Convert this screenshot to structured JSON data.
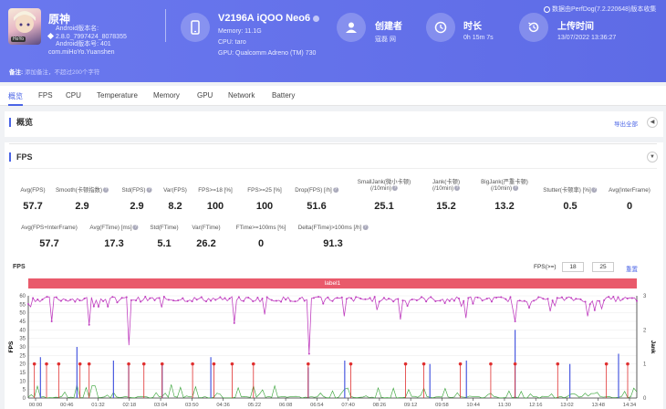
{
  "app": {
    "name": "原神",
    "meta": [
      "Android版本名:",
      "2.8.0_7997424_8078355",
      "Android版本号: 401",
      "com.miHoYo.Yuanshen"
    ],
    "icon_badge": "HoYo"
  },
  "device": {
    "title": "V2196A iQOO Neo6",
    "memory": "Memory: 11.1G",
    "cpu": "CPU: taro",
    "gpu": "GPU: Qualcomm Adreno (TM) 730"
  },
  "creator": {
    "title": "创建者",
    "value": "寇磊 网"
  },
  "duration": {
    "title": "时长",
    "value": "0h 15m 7s"
  },
  "upload": {
    "title": "上传时间",
    "value": "13/07/2022 13:36:27"
  },
  "version_note": "数据由PerfDog(7.2.220648)版本收集",
  "remark": {
    "label": "备注:",
    "placeholder": "添加备注，不超过200个字符"
  },
  "tabs": [
    "概览",
    "FPS",
    "CPU",
    "Temperature",
    "Memory",
    "GPU",
    "Network",
    "Battery"
  ],
  "overview": {
    "title": "概览",
    "export": "导出全部"
  },
  "fps_section": {
    "title": "FPS",
    "row1": [
      {
        "label": "Avg(FPS)",
        "value": "57.7",
        "help": false
      },
      {
        "label": "Smooth(卡顿指数)",
        "value": "2.9",
        "help": true
      },
      {
        "label": "Std(FPS)",
        "value": "2.9",
        "help": true
      },
      {
        "label": "Var(FPS)",
        "value": "8.2",
        "help": false
      },
      {
        "label": "FPS>=18 [%]",
        "value": "100",
        "help": false
      },
      {
        "label": "FPS>=25 [%]",
        "value": "100",
        "help": false
      },
      {
        "label": "Drop(FPS) [/h]",
        "value": "51.6",
        "help": true
      },
      {
        "label": "SmallJank(微小卡顿)\n(/10min)",
        "value": "25.1",
        "help": true
      },
      {
        "label": "Jank(卡顿)\n(/10min)",
        "value": "15.2",
        "help": true
      },
      {
        "label": "BigJank(严重卡顿)\n(/10min)",
        "value": "13.2",
        "help": true
      },
      {
        "label": "Stutter(卡顿率) [%]",
        "value": "0.5",
        "help": true
      },
      {
        "label": "Avg(InterFrame)",
        "value": "0",
        "help": false
      }
    ],
    "row2": [
      {
        "label": "Avg(FPS+InterFrame)",
        "value": "57.7",
        "help": false
      },
      {
        "label": "Avg(FTime) [ms]",
        "value": "17.3",
        "help": true
      },
      {
        "label": "Std(FTime)",
        "value": "5.1",
        "help": false
      },
      {
        "label": "Var(FTime)",
        "value": "26.2",
        "help": false
      },
      {
        "label": "FTime>=100ms [%]",
        "value": "0",
        "help": false
      },
      {
        "label": "Delta(FTime)>100ms [/h]",
        "value": "91.3",
        "help": true
      }
    ],
    "chart_title": "FPS",
    "fps_filter_label": "FPS(>=)",
    "fps_filter_values": [
      "18",
      "25"
    ],
    "reset": "重置",
    "label_bar": "label1"
  },
  "chart_data": {
    "type": "line",
    "title": "FPS",
    "ylabel": "FPS",
    "y2label": "Jank",
    "ylim": [
      0,
      60
    ],
    "yticks": [
      0,
      5,
      10,
      15,
      20,
      25,
      30,
      35,
      40,
      45,
      50,
      55,
      60
    ],
    "y2lim": [
      0,
      3
    ],
    "y2ticks": [
      0,
      1,
      2,
      3
    ],
    "x_ticks": [
      "00:00",
      "00:46",
      "01:32",
      "02:18",
      "03:04",
      "03:50",
      "04:36",
      "05:22",
      "06:08",
      "06:54",
      "07:40",
      "08:26",
      "09:12",
      "09:58",
      "10:44",
      "11:30",
      "12:16",
      "13:02",
      "13:48",
      "14:34"
    ],
    "series": [
      {
        "name": "FPS",
        "color": "#c040c0",
        "baseline": 58,
        "dips": [
          [
            0.04,
            45
          ],
          [
            0.1,
            48
          ],
          [
            0.165,
            31
          ],
          [
            0.34,
            44
          ],
          [
            0.39,
            49
          ],
          [
            0.46,
            26
          ],
          [
            0.52,
            48
          ],
          [
            0.61,
            46
          ],
          [
            0.72,
            47
          ],
          [
            0.8,
            45
          ],
          [
            0.92,
            48
          ]
        ]
      },
      {
        "name": "Jank",
        "color": "#4a5ae0",
        "spikes": [
          [
            0.02,
            1.2
          ],
          [
            0.08,
            1.5
          ],
          [
            0.14,
            1.1
          ],
          [
            0.165,
            1.0
          ],
          [
            0.22,
            1.0
          ],
          [
            0.3,
            1.2
          ],
          [
            0.46,
            0.9
          ],
          [
            0.52,
            1.1
          ],
          [
            0.66,
            1.0
          ],
          [
            0.72,
            1.1
          ],
          [
            0.8,
            2.0
          ],
          [
            0.89,
            1.0
          ],
          [
            0.97,
            1.3
          ]
        ]
      },
      {
        "name": "BigJank",
        "color": "#e03030",
        "points": [
          0.01,
          0.03,
          0.05,
          0.085,
          0.1,
          0.165,
          0.19,
          0.22,
          0.27,
          0.305,
          0.335,
          0.37,
          0.46,
          0.53,
          0.62,
          0.65,
          0.71,
          0.76,
          0.8,
          0.87,
          0.95,
          0.985
        ]
      },
      {
        "name": "SmallJank",
        "color": "#30a030"
      }
    ]
  }
}
